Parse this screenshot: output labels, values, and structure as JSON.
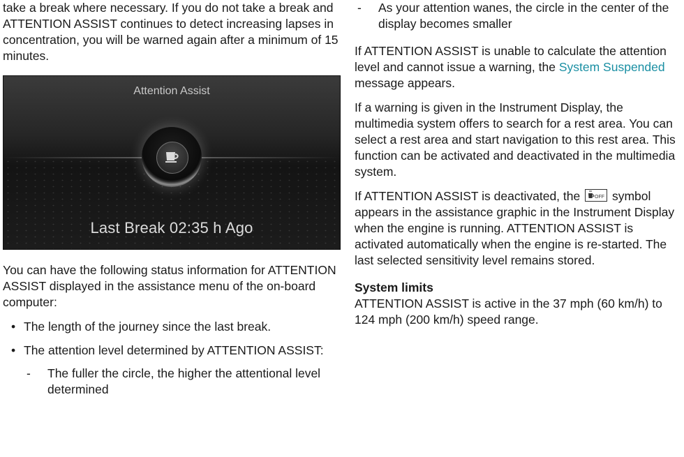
{
  "left": {
    "para1": "take a break where necessary. If you do not take a break and ATTENTION ASSIST continues to detect increasing lapses in concentration, you will be warned again after a minimum of 15 minutes.",
    "display": {
      "title": "Attention Assist",
      "last_break": "Last Break 02:35 h Ago",
      "icon": "coffee-cup-icon"
    },
    "para2": "You can have the following status information for ATTENTION ASSIST displayed in the assistance menu of the on-board computer:",
    "bullets": [
      "The length of the journey since the last break.",
      "The attention level determined by ATTENTION ASSIST:"
    ],
    "dash1": "The fuller the circle, the higher the attentional level determined"
  },
  "right": {
    "dash2": "As your attention wanes, the circle in the center of the display becomes smaller",
    "para_unable_pre": "If ATTENTION ASSIST is unable to calculate the attention level and cannot issue a warning, the",
    "system_suspended": "System Suspended",
    "para_unable_post": "message appears.",
    "para_warning": "If a warning is given in the Instrument Display, the multimedia system offers to search for a rest area. You can select a rest area and start navigation to this rest area. This function can be activated and deactivated in the multimedia system.",
    "para_deact_pre": "If ATTENTION ASSIST is deactivated, the",
    "symbol_text": "OFF",
    "para_deact_post": "symbol appears in the assistance graphic in the Instrument Display when the engine is running. ATTENTION ASSIST is activated automatically when the engine is re-started. The last selected sensitivity level remains stored.",
    "heading": "System limits",
    "limits": "ATTENTION ASSIST is active in the 37 mph (60 km/h) to 124 mph (200 km/h) speed range."
  },
  "colors": {
    "link": "#1a8fa3",
    "text": "#1a1a1a"
  }
}
